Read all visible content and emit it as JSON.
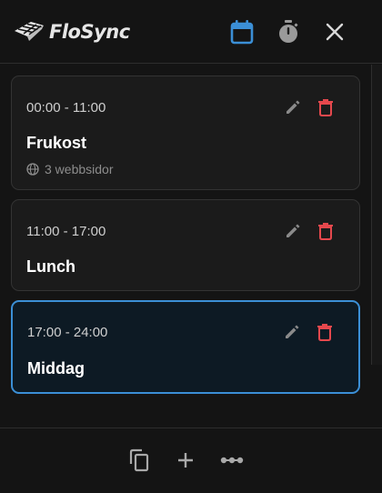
{
  "app": {
    "name": "FloSync",
    "accent_color": "#3b8fd6",
    "danger_color": "#e5484d"
  },
  "header": {
    "icons": [
      "calendar-icon",
      "stopwatch-icon",
      "close-icon"
    ]
  },
  "schedules": [
    {
      "time": "00:00 - 11:00",
      "title": "Frukost",
      "meta": "3 webbsidor",
      "active": false
    },
    {
      "time": "11:00 - 17:00",
      "title": "Lunch",
      "meta": "",
      "active": false
    },
    {
      "time": "17:00 - 24:00",
      "title": "Middag",
      "meta": "",
      "active": true
    }
  ],
  "footer": {
    "icons": [
      "copy-icon",
      "plus-icon",
      "more-icon"
    ]
  }
}
